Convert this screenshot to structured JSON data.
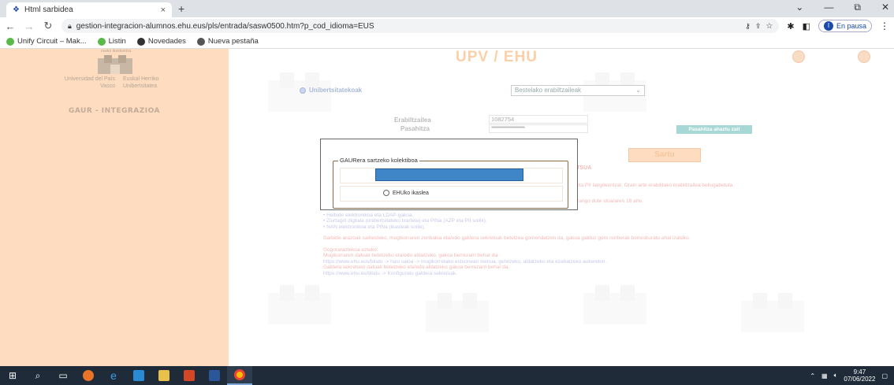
{
  "browser": {
    "tab_title": "Html sarbidea",
    "tab_close": "×",
    "new_tab": "+",
    "win_controls": [
      "⌄",
      "—",
      "⧉",
      "✕"
    ],
    "url": "gestion-integracion-alumnos.ehu.eus/pls/entrada/sasw0500.htm?p_cod_idioma=EUS",
    "pause_label": "En pausa",
    "bookmarks": [
      {
        "label": "Unify Circuit – Mak...",
        "color": "#5bb84a"
      },
      {
        "label": "Listin",
        "color": "#5bb84a"
      },
      {
        "label": "Novedades",
        "color": "#333333"
      },
      {
        "label": "Nueva pestaña",
        "color": "#555555"
      }
    ]
  },
  "left": {
    "logo_caption": "eusko ikaskuntza",
    "uni_left": "Universidad del País Vasco",
    "uni_right": "Euskal Herriko Unibertsitatea",
    "section": "GAUR - INTEGRAZIOA"
  },
  "header": {
    "title": "UPV / EHU"
  },
  "login": {
    "radio_label": "Unibertsitatekoak",
    "select_value": "Bestelako erabiltzaileak",
    "user_label": "Erabiltzailea",
    "user_value": "1082754",
    "pass_label": "Pasahitza",
    "pass_value": "•••••••••••••••••••••••••••••",
    "pass_forgot": "Pasahitza ahaztu zait",
    "submit": "Sartu"
  },
  "notice": {
    "heading": "ZITSUA",
    "line1": "P eta PII langileentzat. Orain arte erabilitako erabiltzailea beliogabetuta",
    "line2": "ll izango dute stoa/aren 18 arte.",
    "other_title": "Sartzeko beste modu batzuk:",
    "other_items": [
      "Helbide elektronikoa eta LDAP-gakoa.",
      "Ziurtagiri digitala (unibertsitateko txartela) eta PINa (AZP eta PII soilik).",
      "NAN elektronikoa eta PINa (ikasleak soilik)."
    ],
    "security": "Sarbide-arazoak saihesteko, mugikorraren zenbakia eta/edo galdera sekretuak betetzea gomendatzen da, gakoa galduz gero norberak berreskuratu ahal izateko.",
    "reminder_title": "Gogoraraztekoa ezteko:",
    "reminder_lines": [
      "Mugikorraren datuak betetzeko eta/edo aldatzeko, gakoa berrezarri behar da.",
      "https://www.ehu.eus/bilatu -> hasi saioa -> mugikorretako estuonean ireinua, gehitzeko, aldatzeko eta ezabatzeko aukerekin.",
      "Galdera sekretuen datuak betetzeko eta/edo aldatzeko gakoa berrezarri behar da.",
      "https://www.ehu.es/bilatu -> Konfiguratu galdera sekretuak."
    ]
  },
  "modal": {
    "legend": "GAURera sartzeko kolektiboa",
    "option": "EHUko ikaslea"
  },
  "taskbar": {
    "time": "9:47",
    "date": "07/06/2022"
  },
  "colors": {
    "accent_left": "#fddcbf",
    "modal_selected": "#3f86c9",
    "taskbar": "#1f2b38"
  }
}
